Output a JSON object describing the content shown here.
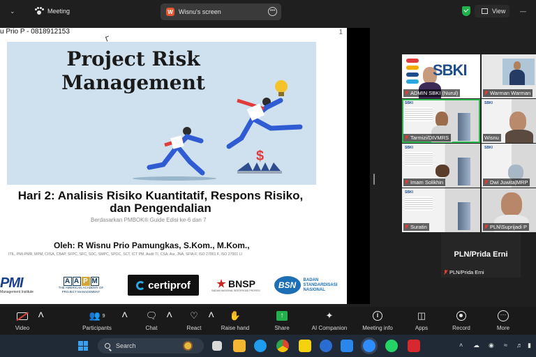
{
  "topbar": {
    "meeting_label": "Meeting",
    "screen_tab_label": "Wisnu's screen",
    "screen_tab_badge": "W",
    "view_label": "View"
  },
  "slide": {
    "presenter_text": "u Prio P - 0818912153",
    "page_number": "1",
    "title_line1": "Project Risk",
    "title_line2": "Management",
    "subtitle_line1": "Hari 2: Analisis Risiko Kuantitatif, Respons Risiko,",
    "subtitle_line2": "dan Pengendalian",
    "basis": "Berdasarkan PMBOK® Guide Edisi ke-6 dan 7",
    "author": "Oleh: R Wisnu Prio Pamungkas, S.Kom., M.Kom.,",
    "certifications": "ITIL, PMI-PMR, MPM, CIISA, CBAP, SFPC, SFC, SDC, SMPC, SPOC, SCT, ICT PM, Audit TI, CSA, Asr, JNA, SFIA-F, ISO 27001 F, ISO 27001 LI",
    "sign_text": "$",
    "logos": {
      "pmi_big": "PMI",
      "pmi_small": "Management Institute",
      "aapm_letters": [
        "A",
        "A",
        "P",
        "M"
      ],
      "aapm_caption": "THE AMERICAN ACADEMY OF PROJECT MANAGEMENT",
      "certiprof": "certiprof",
      "bnsp": "BNSP",
      "bnsp_caption": "BADAN NASIONAL SERTIFIKASI PROFESI",
      "bsn_mark": "BSN",
      "bsn_line1": "BADAN",
      "bsn_line2": "STANDARDISASI",
      "bsn_line3": "NASIONAL"
    }
  },
  "participants": [
    {
      "name": "ADMIN SBKI (Nurul)",
      "logo": "SBKI"
    },
    {
      "name": "Warman Warman"
    },
    {
      "name": "Tarmizi/DIVMRS"
    },
    {
      "name": "Wisnu"
    },
    {
      "name": "Imam Solikhin"
    },
    {
      "name": "Dwi Juwita|MRP"
    },
    {
      "name": "Suratin"
    },
    {
      "name": "PLN\\Suprijadi P"
    }
  ],
  "featured": {
    "display_name": "PLN/Prida Erni",
    "name_tag": "PLN/Prida Erni"
  },
  "toolbar": {
    "video": "Video",
    "participants": "Participants",
    "participants_count": "9",
    "chat": "Chat",
    "react": "React",
    "raise_hand": "Raise hand",
    "share": "Share",
    "ai_companion": "AI Companion",
    "meeting_info": "Meeting info",
    "apps": "Apps",
    "record": "Record",
    "more": "More"
  },
  "taskbar": {
    "search_label": "Search"
  },
  "colors": {
    "accent_green": "#22b14c",
    "mute_red": "#e03c31",
    "sbki_blue": "#1f4e8c",
    "taskbar": "#1f2a36"
  },
  "icons": [
    "chevron-down-icon",
    "zoom-paw-icon",
    "more-icon",
    "shield-check-icon",
    "view-icon",
    "mic-off-icon",
    "video-off-icon",
    "participants-icon",
    "chat-icon",
    "react-icon",
    "raise-hand-icon",
    "share-icon",
    "ai-companion-icon",
    "info-icon",
    "apps-icon",
    "record-icon",
    "windows-icon",
    "search-icon"
  ]
}
